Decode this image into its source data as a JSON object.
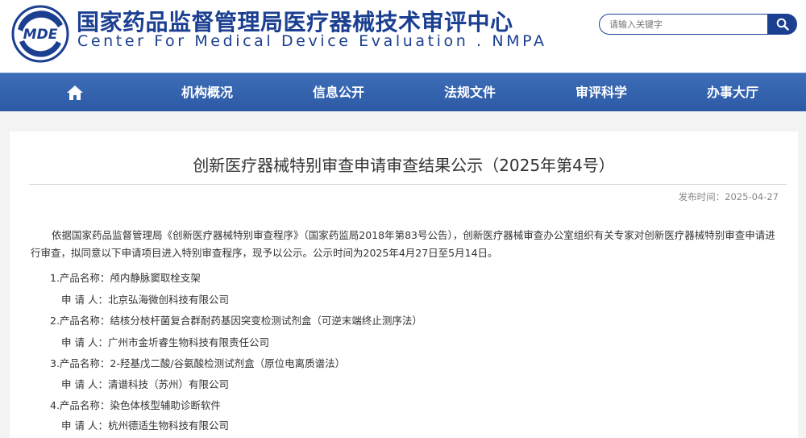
{
  "header": {
    "logo_text": "MDE",
    "title_cn": "国家药品监督管理局医疗器械技术审评中心",
    "title_en": "Center For Medical Device Evaluation . NMPA",
    "search_placeholder": "请输入关键字"
  },
  "nav": {
    "items": [
      {
        "label": "机构概况"
      },
      {
        "label": "信息公开"
      },
      {
        "label": "法规文件"
      },
      {
        "label": "审评科学"
      },
      {
        "label": "办事大厅"
      }
    ]
  },
  "article": {
    "title": "创新医疗器械特别审查申请审查结果公示（2025年第4号）",
    "publish_time": "发布时间：2025-04-27",
    "intro": "依据国家药品监督管理局《创新医疗器械特别审查程序》（国家药监局2018年第83号公告），创新医疗器械审查办公室组织有关专家对创新医疗器械特别审查申请进行审查，拟同意以下申请项目进入特别审查程序，现予以公示。公示时间为2025年4月27日至5月14日。",
    "products": [
      {
        "name": "1.产品名称：颅内静脉窦取栓支架",
        "applicant": "申 请 人：北京弘海微创科技有限公司"
      },
      {
        "name": "2.产品名称：结核分枝杆菌复合群耐药基因突变检测试剂盒（可逆末端终止测序法）",
        "applicant": "申 请 人：广州市金圻睿生物科技有限责任公司"
      },
      {
        "name": "3.产品名称：2-羟基戊二酸/谷氨酸检测试剂盒（原位电离质谱法）",
        "applicant": "申 请 人：清谱科技（苏州）有限公司"
      },
      {
        "name": "4.产品名称：染色体核型辅助诊断软件",
        "applicant": "申 请 人：杭州德适生物科技有限公司"
      }
    ]
  },
  "colors": {
    "brand_blue": "#1b3f91",
    "nav_blue": "#2f5ea8"
  }
}
